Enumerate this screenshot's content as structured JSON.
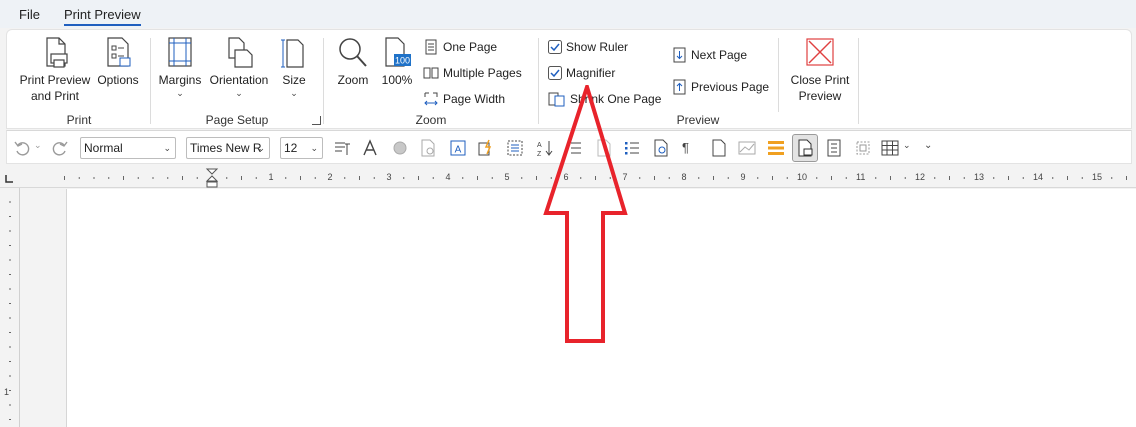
{
  "tabs": [
    {
      "label": "File",
      "active": false
    },
    {
      "label": "Print Preview",
      "active": true
    }
  ],
  "ribbon": {
    "print_group": {
      "label": "Print",
      "print_preview_and_print_line1": "Print Preview",
      "print_preview_and_print_line2": "and Print",
      "options": "Options"
    },
    "page_setup_group": {
      "label": "Page Setup",
      "margins": "Margins",
      "orientation": "Orientation",
      "size": "Size"
    },
    "zoom_group": {
      "label": "Zoom",
      "zoom": "Zoom",
      "zoom_100": "100%",
      "zoom_100_icon_text": "100",
      "one_page": "One Page",
      "multiple_pages": "Multiple Pages",
      "page_width": "Page Width"
    },
    "preview_group": {
      "label": "Preview",
      "show_ruler": "Show Ruler",
      "show_ruler_checked": true,
      "magnifier": "Magnifier",
      "magnifier_checked": true,
      "shrink_one_page": "Shrink One Page",
      "next_page": "Next Page",
      "previous_page": "Previous Page",
      "close_print_preview_line1": "Close Print",
      "close_print_preview_line2": "Preview"
    }
  },
  "toolbar": {
    "style_value": "Normal",
    "font_value": "Times New R",
    "size_value": "12"
  },
  "ruler": {
    "numbers": [
      "1",
      "2",
      "3",
      "4",
      "5",
      "6",
      "7",
      "8",
      "9",
      "10",
      "11",
      "12",
      "13",
      "14",
      "15"
    ]
  },
  "colors": {
    "accent": "#1f5fbf",
    "annotation_arrow": "#e8232b",
    "close_icon": "#e04040",
    "highlight_icon": "#f0a020"
  }
}
